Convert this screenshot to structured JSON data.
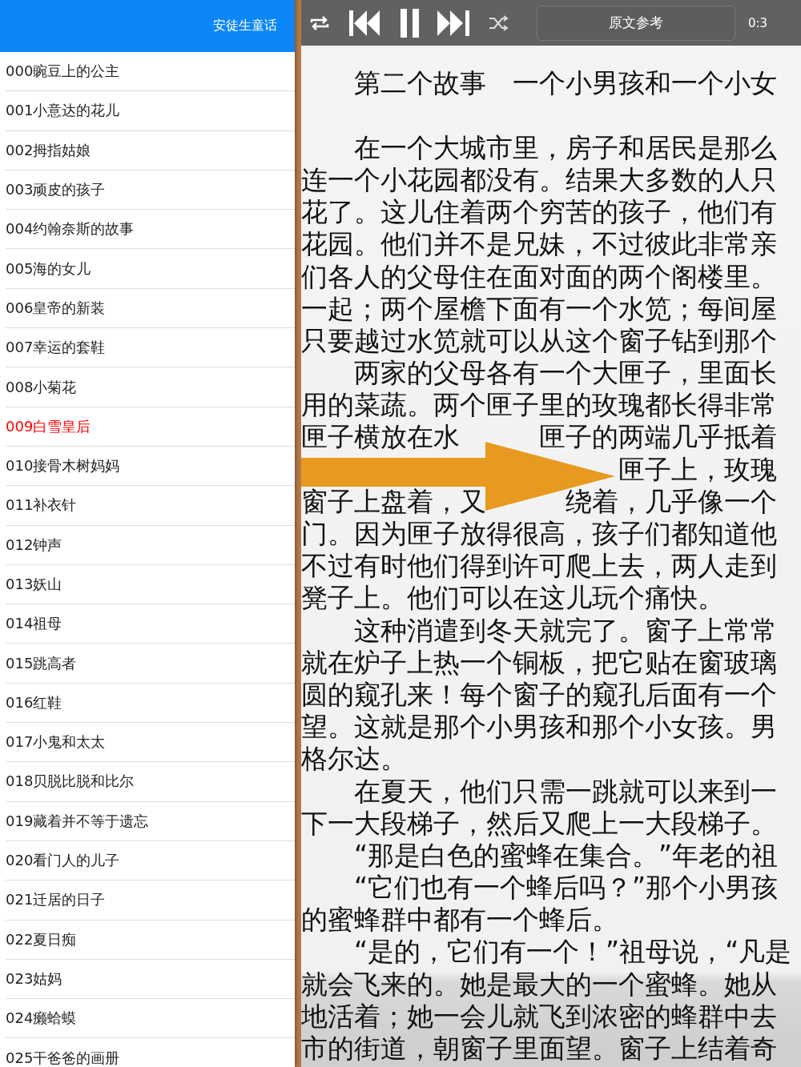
{
  "sidebar": {
    "title": "安徒生童话",
    "items": [
      {
        "label": "000豌豆上的公主",
        "selected": false
      },
      {
        "label": "001小意达的花儿",
        "selected": false
      },
      {
        "label": "002拇指姑娘",
        "selected": false
      },
      {
        "label": "003顽皮的孩子",
        "selected": false
      },
      {
        "label": "004约翰奈斯的故事",
        "selected": false
      },
      {
        "label": "005海的女儿",
        "selected": false
      },
      {
        "label": "006皇帝的新装",
        "selected": false
      },
      {
        "label": "007幸运的套鞋",
        "selected": false
      },
      {
        "label": "008小菊花",
        "selected": false
      },
      {
        "label": "009白雪皇后",
        "selected": true
      },
      {
        "label": "010接骨木树妈妈",
        "selected": false
      },
      {
        "label": "011补衣针",
        "selected": false
      },
      {
        "label": "012钟声",
        "selected": false
      },
      {
        "label": "013妖山",
        "selected": false
      },
      {
        "label": "014祖母",
        "selected": false
      },
      {
        "label": "015跳高者",
        "selected": false
      },
      {
        "label": "016红鞋",
        "selected": false
      },
      {
        "label": "017小鬼和太太",
        "selected": false
      },
      {
        "label": "018贝脱比脱和比尔",
        "selected": false
      },
      {
        "label": "019藏着并不等于遗忘",
        "selected": false
      },
      {
        "label": "020看门人的儿子",
        "selected": false
      },
      {
        "label": "021迁居的日子",
        "selected": false
      },
      {
        "label": "022夏日痴",
        "selected": false
      },
      {
        "label": "023姑妈",
        "selected": false
      },
      {
        "label": "024癞蛤蟆",
        "selected": false
      },
      {
        "label": "025干爸爸的画册",
        "selected": false
      }
    ]
  },
  "player": {
    "original_text_button": "原文参考",
    "time": "0:3"
  },
  "reader": {
    "lines": [
      {
        "kind": "blank"
      },
      {
        "kind": "blank"
      },
      {
        "kind": "title",
        "text": "第二个故事　一个小男孩和一个小女"
      },
      {
        "kind": "blank"
      },
      {
        "kind": "para",
        "text": "在一个大城市里，房子和居民是那么"
      },
      {
        "kind": "body",
        "text": "连一个小花园都没有。结果大多数的人只"
      },
      {
        "kind": "body",
        "text": "花了。这儿住着两个穷苦的孩子，他们有"
      },
      {
        "kind": "body",
        "text": "花园。他们并不是兄妹，不过彼此非常亲"
      },
      {
        "kind": "body",
        "text": "们各人的父母住在面对面的两个阁楼里。"
      },
      {
        "kind": "body",
        "text": "一起；两个屋檐下面有一个水笕；每间屋"
      },
      {
        "kind": "body",
        "text": "只要越过水笕就可以从这个窗子钻到那个"
      },
      {
        "kind": "para",
        "text": "两家的父母各有一个大匣子，里面长"
      },
      {
        "kind": "body",
        "text": "用的菜蔬。两个匣子里的玫瑰都长得非常"
      },
      {
        "kind": "interrupted",
        "parts": [
          "匣子横放在水",
          "匣子的两端几乎抵着"
        ]
      },
      {
        "kind": "covered",
        "text": "匣子上，玫瑰"
      },
      {
        "kind": "interrupted",
        "parts": [
          "窗子上盘着，又",
          "绕着，几乎像一个"
        ]
      },
      {
        "kind": "body",
        "text": "门。因为匣子放得很高，孩子们都知道他"
      },
      {
        "kind": "body",
        "text": "不过有时他们得到许可爬上去，两人走到"
      },
      {
        "kind": "body",
        "text": "凳子上。他们可以在这儿玩个痛快。"
      },
      {
        "kind": "para",
        "text": "这种消遣到冬天就完了。窗子上常常"
      },
      {
        "kind": "body",
        "text": "就在炉子上热一个铜板，把它贴在窗玻璃"
      },
      {
        "kind": "body",
        "text": "圆的窥孔来！每个窗子的窥孔后面有一个"
      },
      {
        "kind": "body",
        "text": "望。这就是那个小男孩和那个小女孩。男"
      },
      {
        "kind": "body",
        "text": "格尔达。"
      },
      {
        "kind": "para",
        "text": "在夏天，他们只需一跳就可以来到一"
      },
      {
        "kind": "body",
        "text": "下一大段梯子，然后又爬上一大段梯子。"
      },
      {
        "kind": "para",
        "text": "“那是白色的蜜蜂在集合。”年老的祖"
      },
      {
        "kind": "para",
        "text": "“它们也有一个蜂后吗？”那个小男孩"
      },
      {
        "kind": "body",
        "text": "的蜜蜂群中都有一个蜂后。"
      },
      {
        "kind": "para",
        "text": "“是的，它们有一个！”祖母说，“凡是"
      },
      {
        "kind": "body",
        "text": "就会飞来的。她是最大的一个蜜蜂。她从"
      },
      {
        "kind": "body",
        "text": "地活着；她一会儿就飞到浓密的蜂群中去"
      },
      {
        "kind": "body",
        "text": "市的街道，朝窗子里面望。窗子上结着奇"
      }
    ]
  }
}
